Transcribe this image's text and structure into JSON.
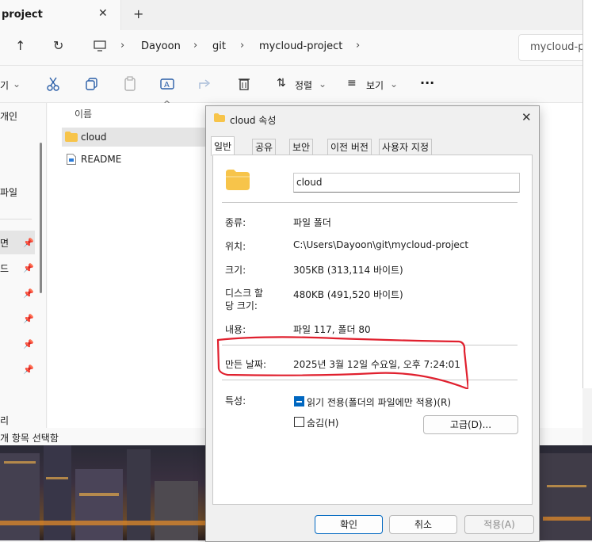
{
  "explorer": {
    "tab_title": "project",
    "breadcrumb": [
      "Dayoon",
      "git",
      "mycloud-project"
    ],
    "search_placeholder": "mycloud-pro",
    "toolbar": {
      "new_partial": "기",
      "sort_label": "정렬",
      "view_label": "보기",
      "more_label": "···"
    },
    "sidebar": [
      "개인",
      "파일",
      "면",
      "드",
      "리"
    ],
    "column_name": "이름",
    "files": [
      {
        "name": "cloud",
        "type": "folder",
        "selected": true
      },
      {
        "name": "README",
        "type": "file",
        "selected": false
      }
    ],
    "status_text": "개 항목 선택함"
  },
  "dialog": {
    "title": "cloud 속성",
    "tabs": [
      "일반",
      "공유",
      "보안",
      "이전 버전",
      "사용자 지정"
    ],
    "active_tab": 0,
    "folder_name": "cloud",
    "properties": [
      {
        "label": "종류:",
        "value": "파일 폴더"
      },
      {
        "label": "위치:",
        "value": "C:\\Users\\Dayoon\\git\\mycloud-project"
      },
      {
        "label": "크기:",
        "value": "305KB (313,114 바이트)"
      },
      {
        "label": "디스크 할\n당 크기:",
        "value": "480KB (491,520 바이트)"
      },
      {
        "label": "내용:",
        "value": "파일 117, 폴더 80"
      },
      {
        "label": "만든 날짜:",
        "value": "2025년 3월 12일 수요일, 오후 7:24:01"
      }
    ],
    "attributes_label": "특성:",
    "readonly_label": "읽기 전용(폴더의 파일에만 적용)(R)",
    "hidden_label": "숨김(H)",
    "advanced_button": "고급(D)...",
    "ok_button": "확인",
    "cancel_button": "취소",
    "apply_button": "적용(A)"
  },
  "colors": {
    "accent": "#0067c0",
    "highlight_annotation": "#e0202e",
    "folder": "#f7c44a"
  }
}
